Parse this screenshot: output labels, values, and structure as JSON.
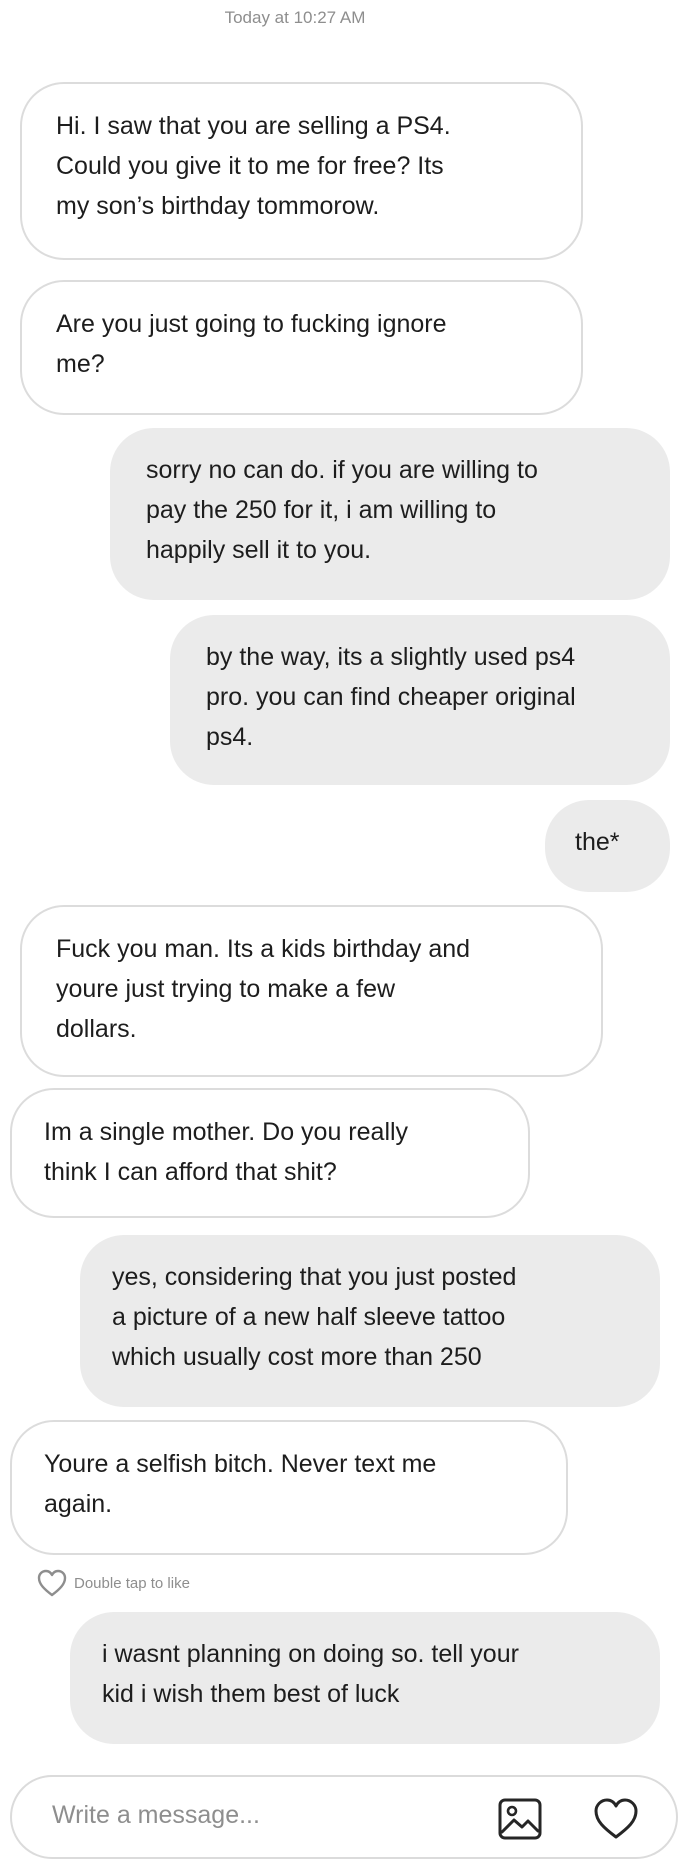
{
  "timestamp": "Today at 10:27 AM",
  "messages": [
    {
      "text": "Hi. I saw that you are selling a PS4.\nCould you give it to me for free? Its\nmy son’s birthday tommorow."
    },
    {
      "text": "Are you just going to fucking ignore\nme?"
    },
    {
      "text": "sorry no can do. if you are willing to\npay the 250 for it, i am willing to\nhappily sell it to you."
    },
    {
      "text": "by the way, its a slightly used ps4\npro. you can find cheaper original\nps4."
    },
    {
      "text": "the*"
    },
    {
      "text": "Fuck you man. Its a kids birthday and\nyoure just trying to make a few\ndollars."
    },
    {
      "text": "Im a single mother. Do you really\nthink I can afford that shit?"
    },
    {
      "text": "yes, considering that you just posted\na picture of a new half sleeve tattoo\nwhich usually cost more than 250"
    },
    {
      "text": "Youre a selfish bitch. Never text me\nagain."
    },
    {
      "text": "i wasnt planning on doing so. tell your\nkid i wish them best of luck"
    }
  ],
  "like_hint": "Double tap to like",
  "composer": {
    "placeholder": "Write a message...",
    "photo_icon": "image-icon",
    "like_icon": "heart-icon"
  },
  "colors": {
    "incoming_bubble": "#ffffff",
    "incoming_border": "#dcdcdc",
    "outgoing_bubble": "#ebebeb",
    "muted_text": "#8e8e8e"
  }
}
